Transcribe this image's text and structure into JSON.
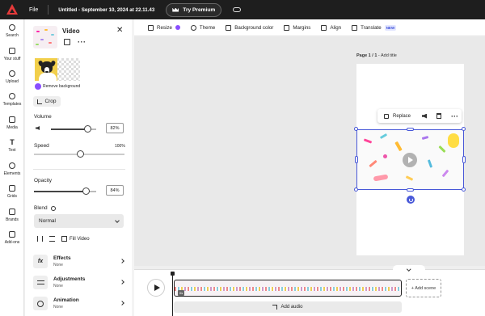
{
  "topbar": {
    "file_label": "File",
    "doc_title": "Untitled - September 10, 2024 at 22.11.43",
    "premium_label": "Try Premium"
  },
  "rail": {
    "items": [
      {
        "label": "Search",
        "icon": "search-icon"
      },
      {
        "label": "Your stuff",
        "icon": "folder-icon"
      },
      {
        "label": "Upload",
        "icon": "upload-icon"
      },
      {
        "label": "Templates",
        "icon": "templates-icon"
      },
      {
        "label": "Media",
        "icon": "media-icon"
      },
      {
        "label": "Text",
        "icon": "text-icon"
      },
      {
        "label": "Elements",
        "icon": "elements-icon"
      },
      {
        "label": "Grids",
        "icon": "grids-icon"
      },
      {
        "label": "Brands",
        "icon": "brands-icon"
      },
      {
        "label": "Add-ons",
        "icon": "addons-icon"
      }
    ]
  },
  "panel": {
    "title": "Video",
    "remove_bg_label": "Remove background",
    "crop_label": "Crop",
    "volume_label": "Volume",
    "volume_value": "82%",
    "volume_level": 0.82,
    "speed_label": "Speed",
    "speed_max": "100%",
    "opacity_label": "Opacity",
    "opacity_value": "84%",
    "opacity_level": 0.84,
    "blend_label": "Blend",
    "blend_value": "Normal",
    "fill_video_label": "Fill Video",
    "sub_items": [
      {
        "name": "Effects",
        "value": "None",
        "icon_text": "fx"
      },
      {
        "name": "Adjustments",
        "value": "None",
        "icon_text": ""
      },
      {
        "name": "Animation",
        "value": "None",
        "icon_text": ""
      }
    ]
  },
  "toolbar": {
    "items": [
      {
        "label": "Resize",
        "icon": "resize-icon"
      },
      {
        "label": "Theme",
        "icon": "theme-icon"
      },
      {
        "label": "Background color",
        "icon": "background-color-icon"
      },
      {
        "label": "Margins",
        "icon": "margins-icon"
      },
      {
        "label": "Align",
        "icon": "align-icon"
      },
      {
        "label": "Translate",
        "icon": "translate-icon"
      }
    ],
    "new_badge": "NEW"
  },
  "canvas": {
    "page_label_prefix": "Page 1 / 1",
    "page_label_title": " - Add title",
    "replace_label": "Replace"
  },
  "timeline": {
    "clip_badge": "0s",
    "add_scene_label": "+ Add scene",
    "add_audio_label": "Add audio"
  },
  "colors": {
    "topbar_bg": "#1e1e1e",
    "selection": "#4858d8",
    "premium_accent": "#8a4fff"
  }
}
